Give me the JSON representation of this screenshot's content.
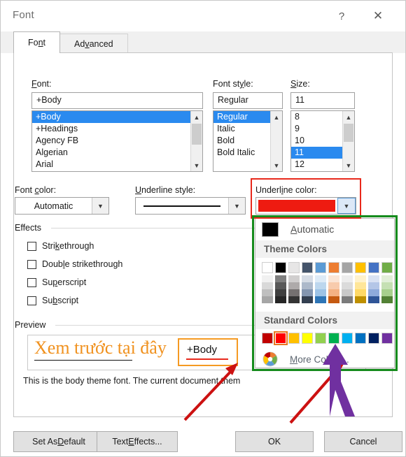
{
  "window": {
    "title": "Font",
    "help_icon": "question-mark-icon",
    "close_icon": "close-icon"
  },
  "tabs": [
    {
      "label": "Font",
      "active": true
    },
    {
      "label": "Advanced",
      "active": false
    }
  ],
  "font_section": {
    "font_label": "Font:",
    "font_value": "+Body",
    "font_options": [
      "+Body",
      "+Headings",
      "Agency FB",
      "Algerian",
      "Arial"
    ],
    "font_selected": "+Body",
    "style_label": "Font style:",
    "style_value": "Regular",
    "style_options": [
      "Regular",
      "Italic",
      "Bold",
      "Bold Italic"
    ],
    "style_selected": "Regular",
    "size_label": "Size:",
    "size_value": "11",
    "size_options": [
      "8",
      "9",
      "10",
      "11",
      "12"
    ],
    "size_selected": "11"
  },
  "color_row": {
    "font_color_label": "Font color:",
    "font_color_value": "Automatic",
    "underline_style_label": "Underline style:",
    "underline_style_value": "solid-line",
    "underline_color_label": "Underline color:",
    "underline_color_value": "#ee1b11"
  },
  "effects": {
    "group_label": "Effects",
    "items": [
      {
        "label": "Strikethrough",
        "checked": false
      },
      {
        "label": "Double strikethrough",
        "checked": false
      },
      {
        "label": "Superscript",
        "checked": false
      },
      {
        "label": "Subscript",
        "checked": false
      }
    ]
  },
  "preview": {
    "group_label": "Preview",
    "sample_text": "Xem trước tại đây",
    "description": "This is the body theme font. The current document them",
    "callout_label": "+Body"
  },
  "color_picker": {
    "automatic_label": "Automatic",
    "automatic_swatch": "#000000",
    "theme_header": "Theme Colors",
    "standard_header": "Standard Colors",
    "more_colors_label": "More Colors...",
    "more_colors_icon": "color-wheel-icon",
    "theme_columns": [
      {
        "base": "#ffffff",
        "variants": [
          "#f1f1f1",
          "#d9d9d9",
          "#bfbfbf",
          "#a6a6a6"
        ]
      },
      {
        "base": "#000000",
        "variants": [
          "#7f7f7f",
          "#595959",
          "#3f3f3f",
          "#262626"
        ]
      },
      {
        "base": "#e7e6e6",
        "variants": [
          "#d0cece",
          "#aeaaaa",
          "#757171",
          "#343434"
        ]
      },
      {
        "base": "#44546a",
        "variants": [
          "#d6dce5",
          "#adb9ca",
          "#8496b0",
          "#333f50"
        ]
      },
      {
        "base": "#5b9bd5",
        "variants": [
          "#deebf7",
          "#bdd7ee",
          "#9dc3e6",
          "#2e75b6"
        ]
      },
      {
        "base": "#ed7d31",
        "variants": [
          "#fbe5d6",
          "#f8cbad",
          "#f4b183",
          "#c55a11"
        ]
      },
      {
        "base": "#a5a5a5",
        "variants": [
          "#ededed",
          "#dbdbdb",
          "#c9c9c9",
          "#7b7b7b"
        ]
      },
      {
        "base": "#ffc000",
        "variants": [
          "#fff2cc",
          "#ffe699",
          "#ffd966",
          "#bf9000"
        ]
      },
      {
        "base": "#4472c4",
        "variants": [
          "#d9e2f3",
          "#b4c6e7",
          "#8eaadb",
          "#2f5597"
        ]
      },
      {
        "base": "#70ad47",
        "variants": [
          "#e2efd9",
          "#c5e0b3",
          "#a8d08d",
          "#538135"
        ]
      }
    ],
    "standard_colors": [
      {
        "color": "#c00000",
        "selected": false
      },
      {
        "color": "#ff0000",
        "selected": true
      },
      {
        "color": "#ffc000",
        "selected": false
      },
      {
        "color": "#ffff00",
        "selected": false
      },
      {
        "color": "#92d050",
        "selected": false
      },
      {
        "color": "#00b050",
        "selected": false
      },
      {
        "color": "#00b0f0",
        "selected": false
      },
      {
        "color": "#0070c0",
        "selected": false
      },
      {
        "color": "#002060",
        "selected": false
      },
      {
        "color": "#7030a0",
        "selected": false
      }
    ]
  },
  "footer_buttons": [
    {
      "label": "Set As Default"
    },
    {
      "label": "Text Effects..."
    },
    {
      "label": "OK"
    },
    {
      "label": "Cancel"
    }
  ],
  "annotations": {
    "red_box_color": "#e8291c",
    "green_box_color": "#158b1c",
    "orange_box_color": "#f59a22",
    "purple_mark_color": "#7030a0"
  }
}
